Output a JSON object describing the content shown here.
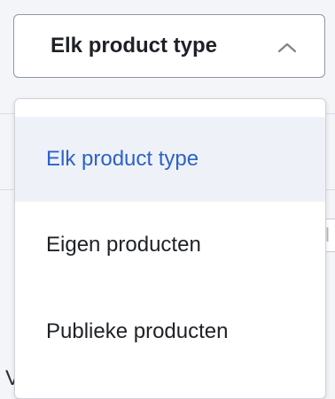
{
  "select": {
    "value": "Elk product type",
    "icon": "chevron-up-icon"
  },
  "menu": {
    "items": [
      {
        "label": "Elk product type",
        "selected": true
      },
      {
        "label": "Eigen producten",
        "selected": false
      },
      {
        "label": "Publieke producten",
        "selected": false
      }
    ]
  },
  "colors": {
    "selected_text": "#2d62c7",
    "selected_bg": "#eef2f8",
    "text": "#1e2126"
  },
  "background": {
    "fragment_text": "l",
    "letter_text": "V"
  }
}
